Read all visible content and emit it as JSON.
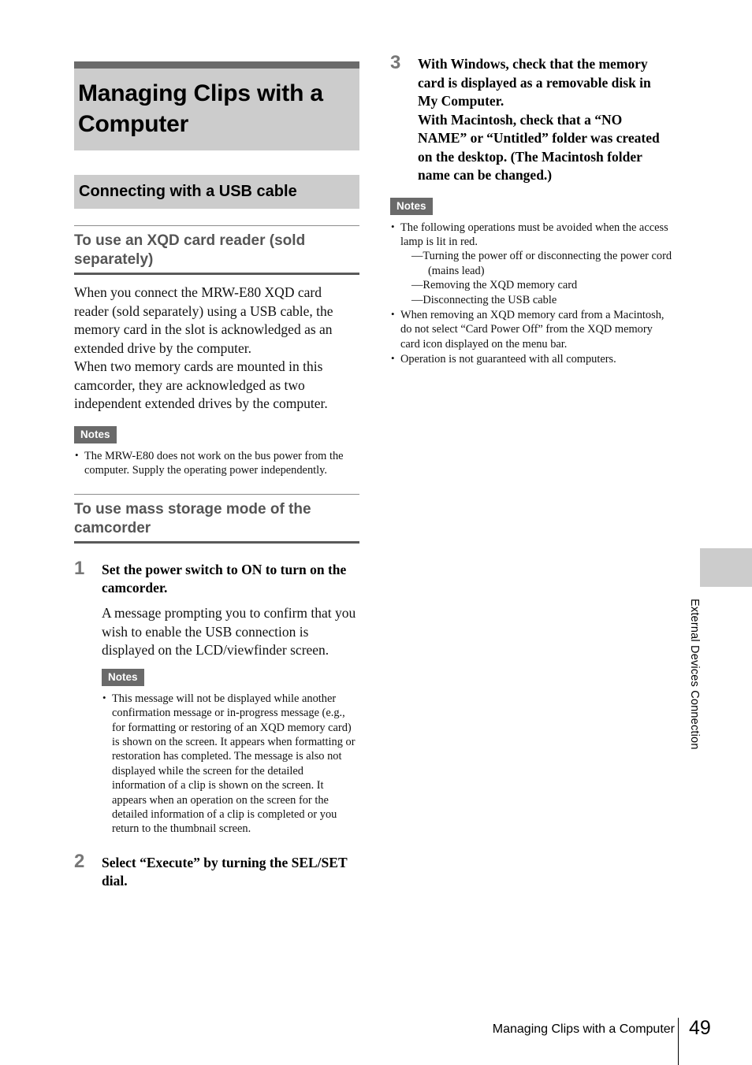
{
  "page": {
    "number": "49",
    "footer_title": "Managing Clips with a Computer",
    "side_tab_label": "External Devices Connection"
  },
  "chapter": {
    "title": "Managing Clips with a Computer"
  },
  "section": {
    "band_title": "Connecting with a USB cable"
  },
  "subsection_card_reader": {
    "heading": "To use an XQD card reader (sold separately)",
    "paragraph_1": "When you connect the MRW-E80 XQD card reader (sold separately) using a USB cable, the memory card in the slot is acknowledged as an extended drive by the computer.",
    "paragraph_2": "When two memory cards are mounted in this camcorder, they are acknowledged as two independent extended drives by the computer.",
    "notes_label": "Notes",
    "notes": [
      "The MRW-E80 does not work on the bus power from the computer. Supply the operating power independently."
    ]
  },
  "subsection_mass_storage": {
    "heading": "To use mass storage mode of the camcorder",
    "steps": [
      {
        "number": "1",
        "title": "Set the power switch to ON to turn on the camcorder.",
        "body": "A message prompting you to confirm that you wish to enable the USB connection is displayed on the LCD/viewfinder screen.",
        "notes_label": "Notes",
        "notes": [
          "This message will not be displayed while another confirmation message or in-progress message (e.g., for formatting or restoring of an XQD memory card) is shown on the screen. It appears when formatting or restoration has completed. The message is also not displayed while the screen for the detailed information of a clip is shown on the screen. It appears when an operation on the screen for the detailed information of a clip is completed or you return to the thumbnail screen."
        ]
      },
      {
        "number": "2",
        "title": "Select “Execute” by turning the SEL/SET dial."
      },
      {
        "number": "3",
        "title_line_1": "With Windows, check that the memory card is displayed as a removable disk in My Computer.",
        "title_line_2": "With Macintosh, check that a “NO NAME” or “Untitled” folder was created on the desktop. (The Macintosh folder name can be changed.)"
      }
    ],
    "notes_label": "Notes",
    "notes_after_step3": {
      "item_1_lead": "The following operations must be avoided when the access lamp is lit in red.",
      "item_1_subitems": [
        "—Turning the power off or disconnecting the power cord (mains lead)",
        "—Removing the XQD memory card",
        "—Disconnecting the USB cable"
      ],
      "item_2": "When removing an XQD memory card from a Macintosh, do not select “Card Power Off” from the XQD memory card icon displayed on the menu bar.",
      "item_3": "Operation is not guaranteed with all computers."
    }
  },
  "colors": {
    "band_gray": "#cccccc",
    "rule_dark": "#6a6a6a",
    "subhead_gray": "#555555",
    "step_number_gray": "#777777"
  }
}
